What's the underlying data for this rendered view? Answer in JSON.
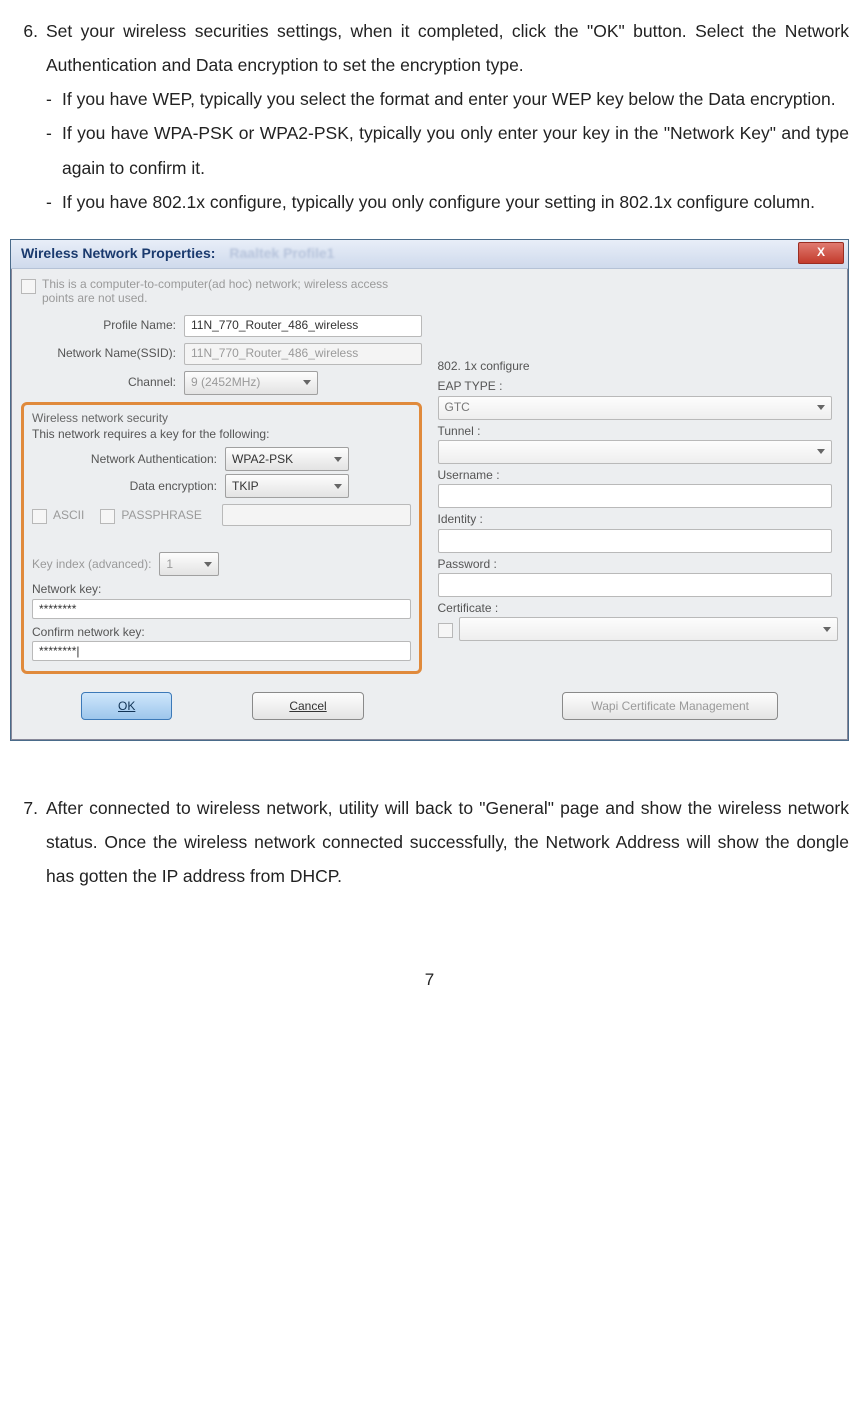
{
  "step6": {
    "num": "6.",
    "intro": "Set your wireless securities settings, when it completed, click the \"OK\" button. Select the Network Authentication and Data encryption to set the encryption type.",
    "bullets": [
      {
        "dash": "-",
        "text": "If you have WEP, typically you select the format and enter your WEP key below the Data encryption."
      },
      {
        "dash": "-",
        "text": "If you have WPA-PSK or WPA2-PSK, typically you only enter your key in the \"Network Key\" and type again to confirm it."
      },
      {
        "dash": "-",
        "text": "If you have 802.1x configure, typically you only configure your setting in 802.1x configure column."
      }
    ]
  },
  "dialog": {
    "title": "Wireless Network Properties:",
    "blur": "Raaltek  Profile1",
    "close": "X",
    "adhoc_checkbox": "This is a computer-to-computer(ad hoc) network; wireless access points are not used.",
    "profile_label": "Profile Name:",
    "profile_value": "11N_770_Router_486_wireless",
    "ssid_label": "Network Name(SSID):",
    "ssid_value": "11N_770_Router_486_wireless",
    "channel_label": "Channel:",
    "channel_value": "9  (2452MHz)",
    "sec_group": "Wireless network security",
    "sec_line": "This network requires a key for the following:",
    "auth_label": "Network Authentication:",
    "auth_value": "WPA2-PSK",
    "enc_label": "Data encryption:",
    "enc_value": "TKIP",
    "ascii": "ASCII",
    "passphrase": "PASSPHRASE",
    "keyindex_label": "Key index (advanced):",
    "keyindex_value": "1",
    "netkey_label": "Network key:",
    "netkey_value": "********",
    "confirm_label": "Confirm network key:",
    "confirm_value": "********|",
    "r_header": "802. 1x configure",
    "eap_label": "EAP TYPE :",
    "eap_value": "GTC",
    "tunnel_label": "Tunnel :",
    "username_label": "Username :",
    "identity_label": "Identity :",
    "password_label": "Password :",
    "cert_label": "Certificate :",
    "ok": "OK",
    "cancel": "Cancel",
    "wapi": "Wapi Certificate Management"
  },
  "step7": {
    "num": "7.",
    "text": "After connected to wireless network, utility will back to \"General\" page and show the wireless network status. Once the wireless network connected successfully, the Network Address will show the dongle has gotten the IP address from DHCP."
  },
  "pagenum": "7"
}
